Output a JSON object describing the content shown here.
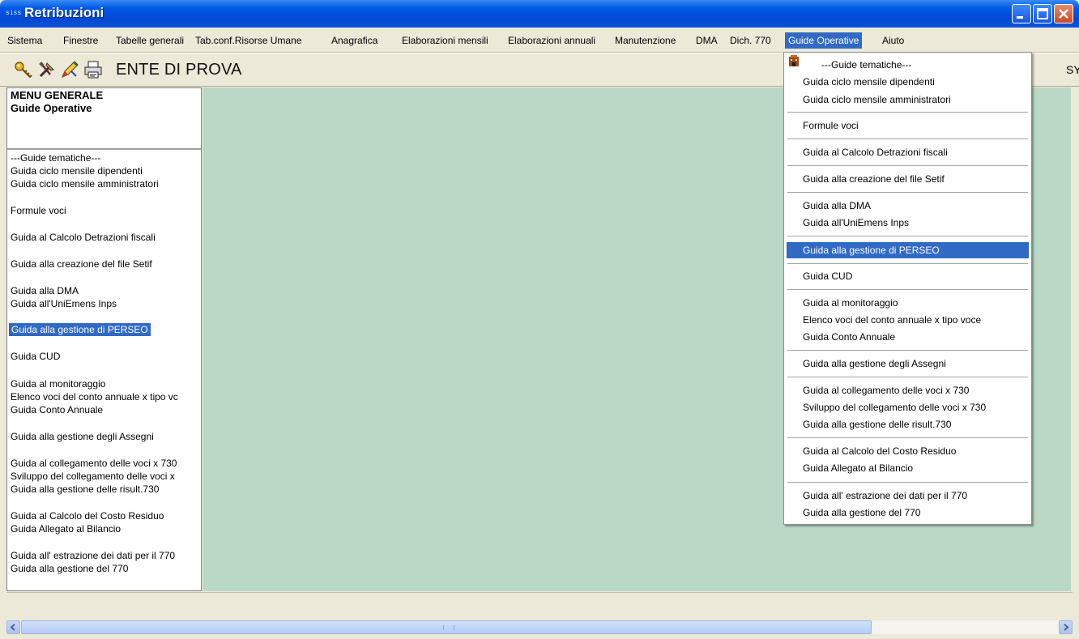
{
  "window": {
    "title": "Retribuzioni",
    "app_icon_text": "siss"
  },
  "menubar": {
    "items": [
      {
        "label": "Sistema"
      },
      {
        "label": "Finestre"
      },
      {
        "label": "Tabelle generali"
      },
      {
        "label": "Tab.conf.Risorse Umane"
      },
      {
        "label": "Anagrafica"
      },
      {
        "label": "Elaborazioni mensili"
      },
      {
        "label": "Elaborazioni annuali"
      },
      {
        "label": "Manutenzione"
      },
      {
        "label": "DMA"
      },
      {
        "label": "Dich. 770"
      },
      {
        "label": "Guide Operative",
        "active": true
      },
      {
        "label": "Aiuto"
      }
    ]
  },
  "toolbar": {
    "entity": "ENTE DI PROVA",
    "right_text": "SY"
  },
  "left_panel": {
    "title1": "MENU GENERALE",
    "title2": "Guide Operative",
    "items": [
      "---Guide tematiche---",
      "Guida ciclo mensile dipendenti",
      "Guida ciclo mensile amministratori",
      "Formule voci",
      "Guida al Calcolo Detrazioni fiscali",
      "Guida alla creazione del file Setif",
      "Guida alla DMA",
      "Guida all'UniEmens Inps",
      "Guida alla gestione di PERSEO",
      "Guida CUD",
      "Guida al monitoraggio",
      "Elenco voci del conto annuale x tipo vc",
      "Guida Conto Annuale",
      "Guida alla gestione degli Assegni",
      "Guida al collegamento delle voci x 730",
      "Sviluppo del collegamento delle voci x",
      "Guida alla gestione delle risult.730",
      "Guida al Calcolo del Costo Residuo",
      "Guida Allegato al Bilancio",
      "Guida all' estrazione dei dati per il 770",
      "Guida alla gestione del 770"
    ],
    "selected_index": 8
  },
  "dropdown": {
    "items": [
      "---Guide tematiche---",
      "Guida ciclo mensile dipendenti",
      "Guida ciclo mensile amministratori",
      "Formule voci",
      "Guida al Calcolo Detrazioni fiscali",
      "Guida alla creazione del file Setif",
      "Guida alla DMA",
      "Guida all'UniEmens Inps",
      "Guida alla gestione di PERSEO",
      "Guida CUD",
      "Guida al monitoraggio",
      "Elenco voci del conto annuale x tipo voce",
      "Guida Conto Annuale",
      "Guida alla gestione degli Assegni",
      "Guida al collegamento delle voci x 730",
      "Sviluppo del collegamento delle voci x 730",
      "Guida alla gestione delle risult.730",
      "Guida al Calcolo del Costo Residuo",
      "Guida Allegato al Bilancio",
      "Guida all' estrazione dei dati per il 770",
      "Guida alla gestione del 770"
    ],
    "highlighted_index": 8
  },
  "icons": {
    "toolbar": [
      "key-icon",
      "tools-icon",
      "pencil-icon",
      "printer-icon"
    ],
    "window": [
      "minimize-icon",
      "maximize-icon",
      "close-icon"
    ],
    "scroll": [
      "arrow-left-icon",
      "arrow-right-icon"
    ]
  },
  "colors": {
    "titlebar": "#0058e6",
    "highlight": "#316ac5",
    "workarea": "#bad8c6",
    "chrome": "#ece9d8"
  }
}
